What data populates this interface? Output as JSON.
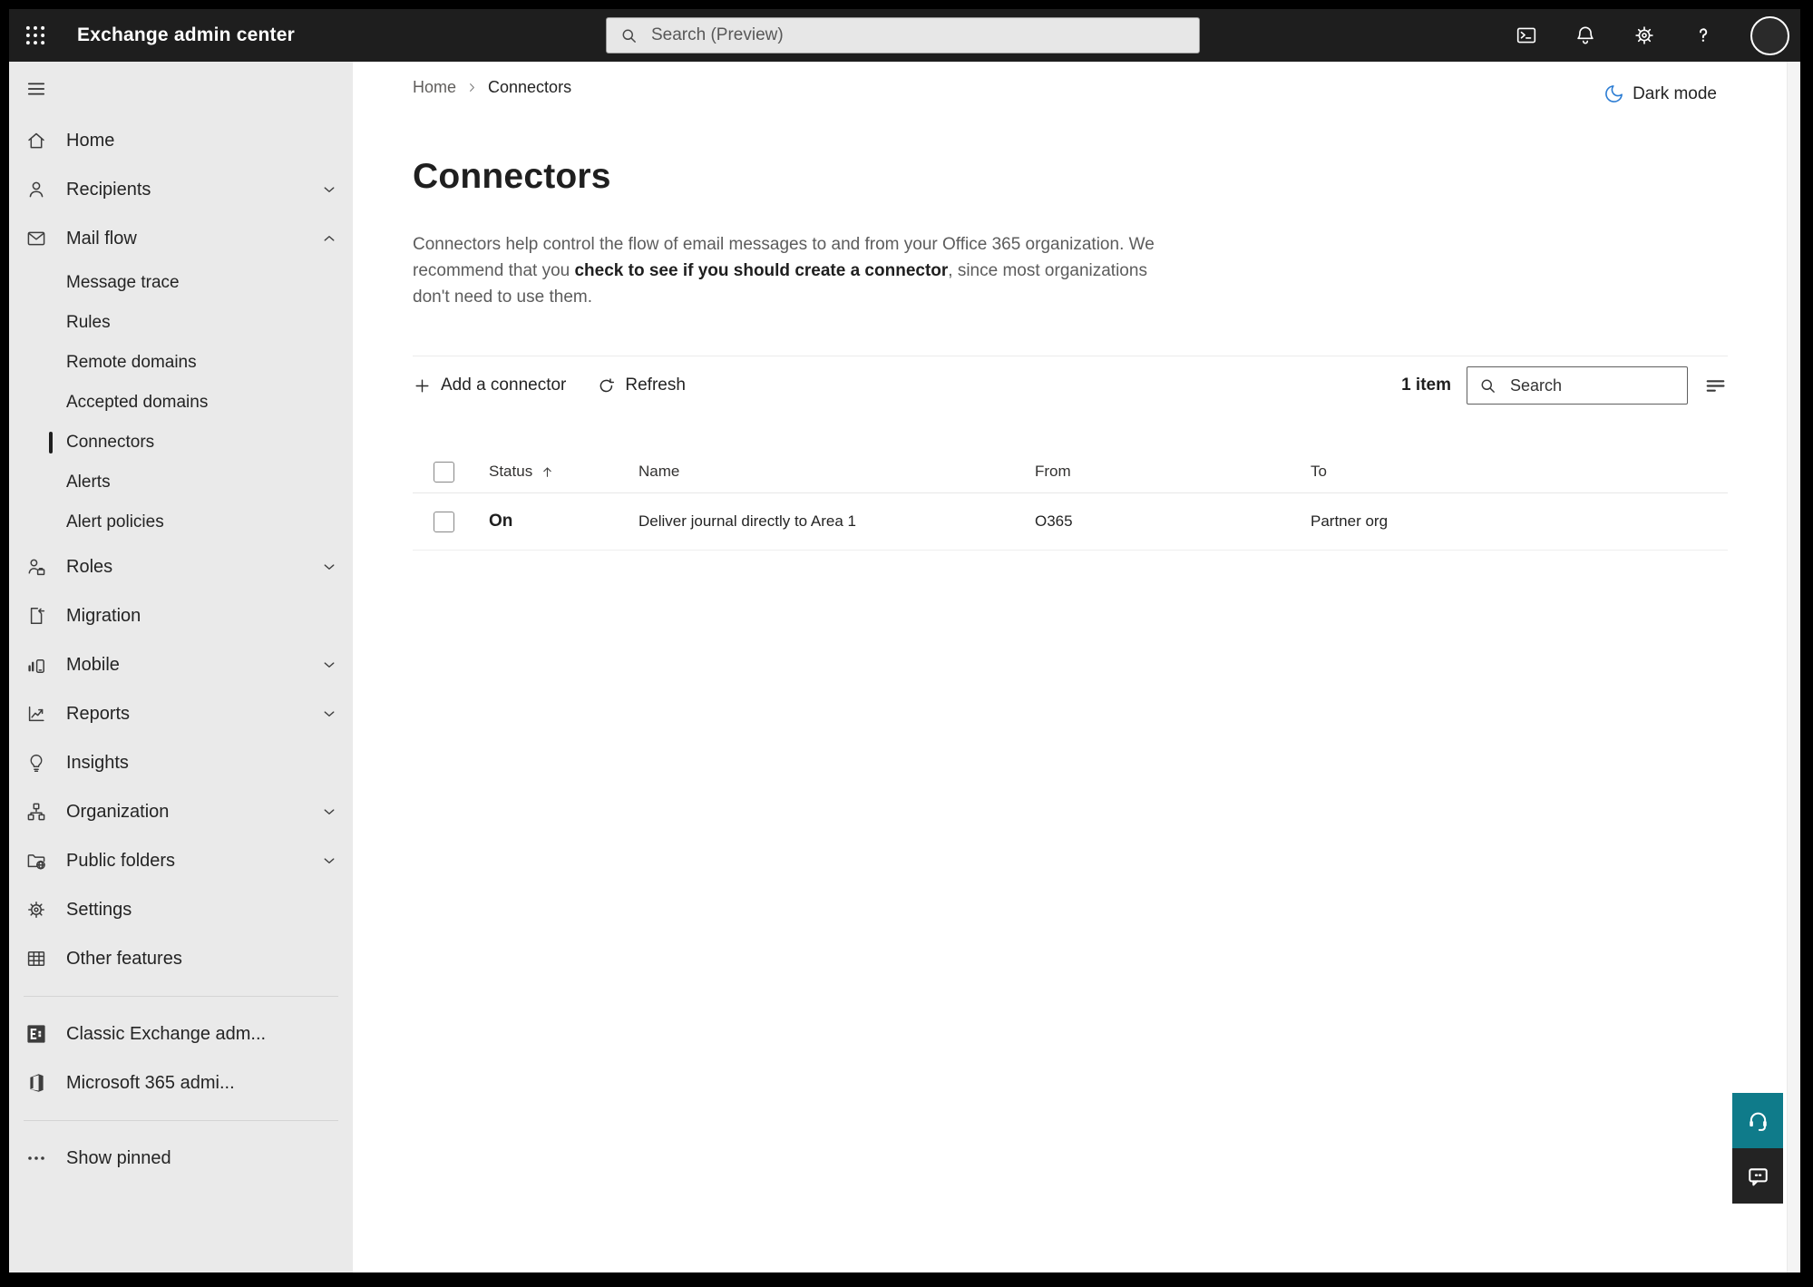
{
  "topbar": {
    "app_title": "Exchange admin center",
    "search_placeholder": "Search (Preview)",
    "icons": [
      "app-launcher-icon",
      "terminal-icon",
      "bell-icon",
      "gear-icon",
      "help-icon",
      "avatar"
    ]
  },
  "breadcrumb": {
    "items": [
      "Home",
      "Connectors"
    ]
  },
  "dark_mode": {
    "label": "Dark mode",
    "icon": "moon-icon",
    "icon_color": "#2b7cd3"
  },
  "page": {
    "title": "Connectors",
    "description_before": "Connectors help control the flow of email messages to and from your Office 365 organization. We recommend that you ",
    "description_emphasis": "check to see if you should create a connector",
    "description_after": ", since most organizations don't need to use them."
  },
  "toolbar": {
    "add_label": "Add a connector",
    "refresh_label": "Refresh",
    "count_label": "1 item",
    "search_placeholder": "Search",
    "icons": [
      "plus-icon",
      "refresh-icon",
      "search-icon",
      "filter-icon"
    ]
  },
  "table": {
    "columns": [
      "Status",
      "Name",
      "From",
      "To"
    ],
    "sort": {
      "column": "Status",
      "direction": "asc",
      "icon": "arrow-up-icon"
    },
    "rows": [
      {
        "status": "On",
        "name": "Deliver journal directly to Area 1",
        "from": "O365",
        "to": "Partner org"
      }
    ]
  },
  "sidebar": {
    "items": [
      {
        "label": "Home",
        "icon": "home",
        "slug": "home"
      },
      {
        "label": "Recipients",
        "icon": "person",
        "chevron": "down",
        "slug": "recipients"
      },
      {
        "label": "Mail flow",
        "icon": "mail",
        "chevron": "up",
        "slug": "mail-flow"
      },
      {
        "label": "Message trace",
        "sub": true,
        "slug": "message-trace"
      },
      {
        "label": "Rules",
        "sub": true,
        "slug": "rules"
      },
      {
        "label": "Remote domains",
        "sub": true,
        "slug": "remote-domains"
      },
      {
        "label": "Accepted domains",
        "sub": true,
        "slug": "accepted-domains"
      },
      {
        "label": "Connectors",
        "sub": true,
        "selected": true,
        "slug": "connectors"
      },
      {
        "label": "Alerts",
        "sub": true,
        "slug": "alerts"
      },
      {
        "label": "Alert policies",
        "sub": true,
        "slug": "alert-policies"
      },
      {
        "label": "Roles",
        "icon": "roles",
        "chevron": "down",
        "slug": "roles"
      },
      {
        "label": "Migration",
        "icon": "migration",
        "slug": "migration"
      },
      {
        "label": "Mobile",
        "icon": "mobile",
        "chevron": "down",
        "slug": "mobile"
      },
      {
        "label": "Reports",
        "icon": "reports",
        "chevron": "down",
        "slug": "reports"
      },
      {
        "label": "Insights",
        "icon": "insights",
        "slug": "insights"
      },
      {
        "label": "Organization",
        "icon": "organization",
        "chevron": "down",
        "slug": "organization"
      },
      {
        "label": "Public folders",
        "icon": "public-folders",
        "chevron": "down",
        "slug": "public-folders"
      },
      {
        "label": "Settings",
        "icon": "settings",
        "slug": "settings"
      },
      {
        "label": "Other features",
        "icon": "other-features",
        "slug": "other-features"
      },
      {
        "divider": true
      },
      {
        "label": "Classic Exchange adm...",
        "icon": "exchange-logo",
        "slug": "classic-exchange-admin"
      },
      {
        "label": "Microsoft 365 admi...",
        "icon": "office-logo",
        "slug": "microsoft-365-admin"
      },
      {
        "divider": true
      },
      {
        "label": "Show pinned",
        "icon": "ellipsis",
        "slug": "show-pinned"
      }
    ]
  },
  "floating_buttons": [
    {
      "slug": "support",
      "icon": "headset",
      "color": "#0f7b8a"
    },
    {
      "slug": "feedback",
      "icon": "chat",
      "color": "#232323"
    }
  ],
  "colors": {
    "topbar_bg": "#1e1e1e",
    "sidebar_bg": "#eaeaea",
    "selected_indicator": "#1f1f1f",
    "support_teal": "#0f7b8a",
    "feedback_dark": "#232323",
    "moon_blue": "#2b7cd3"
  }
}
